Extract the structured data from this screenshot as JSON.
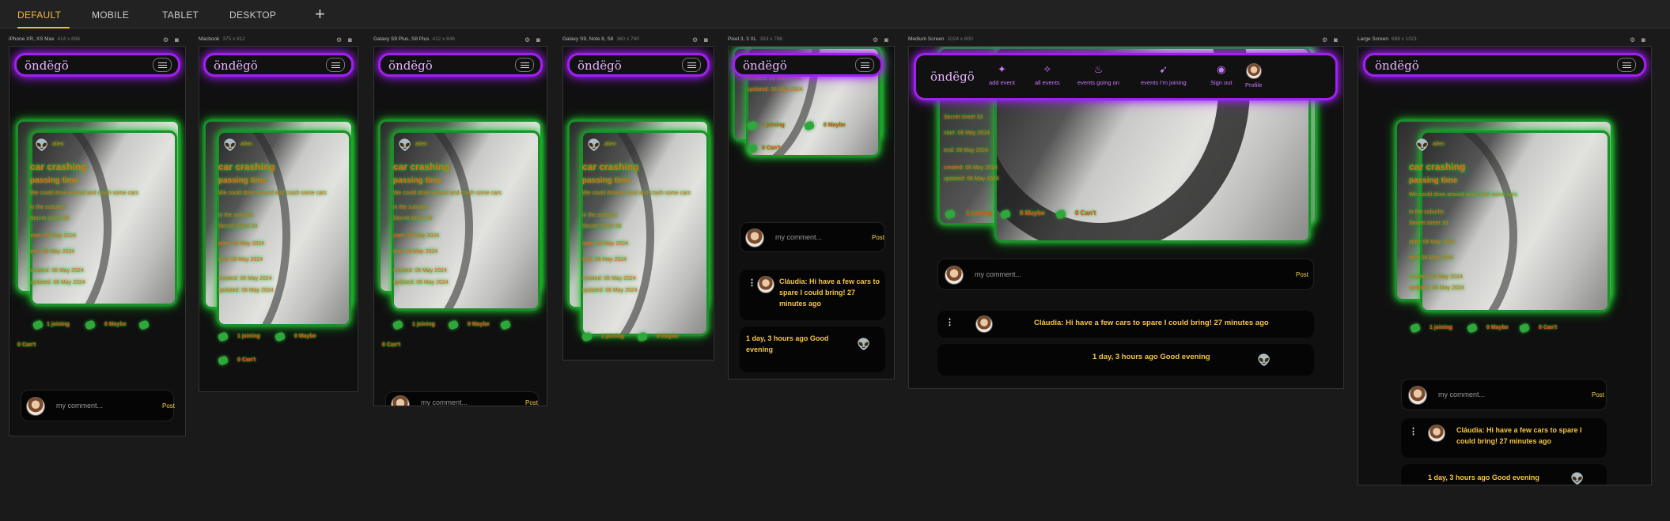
{
  "tabs": [
    {
      "label": "DEFAULT"
    },
    {
      "label": "MOBILE"
    },
    {
      "label": "TABLET"
    },
    {
      "label": "DESKTOP"
    }
  ],
  "add_label": "+",
  "brand": "öndëgö",
  "devices": [
    {
      "name": "iPhone XR, XS Max",
      "size": "414 x 896"
    },
    {
      "name": "Macbook",
      "size": "375 x 812"
    },
    {
      "name": "Galaxy S9 Plus, S8 Plus",
      "size": "412 x 846"
    },
    {
      "name": "Galaxy S9, Note 8, S8",
      "size": "360 x 740"
    },
    {
      "name": "Pixel 3, 3 XL",
      "size": "393 x 786"
    },
    {
      "name": "Medium Screen",
      "size": "1024 x 800"
    },
    {
      "name": "Large Screen",
      "size": "688 x 1021"
    }
  ],
  "event": {
    "user": "alien",
    "title": "car crashing",
    "subtitle": "passing time",
    "desc": "We could drive around and crash some cars",
    "desc2": "in the suburbs",
    "address": "Secret street 33",
    "start": "start: 08 May 2024",
    "end": "end: 09 May 2024",
    "created": "created: 06 May 2024",
    "updated": "updated: 06 May 2024",
    "joining": "1 joining",
    "maybe": "0 Maybe",
    "cant": "0 Can't"
  },
  "comment": {
    "placeholder": "my comment...",
    "post": "Post"
  },
  "messages": [
    {
      "text": "Cláudia: Hi have a few cars to spare I could bring! 27 minutes ago"
    },
    {
      "text": "1 day, 3 hours ago Good evening"
    }
  ],
  "nav": {
    "add": "add event",
    "all": "all events",
    "going": "events going on",
    "joining": "events I'm joining",
    "signout": "Sign out",
    "profile": "Profile"
  }
}
